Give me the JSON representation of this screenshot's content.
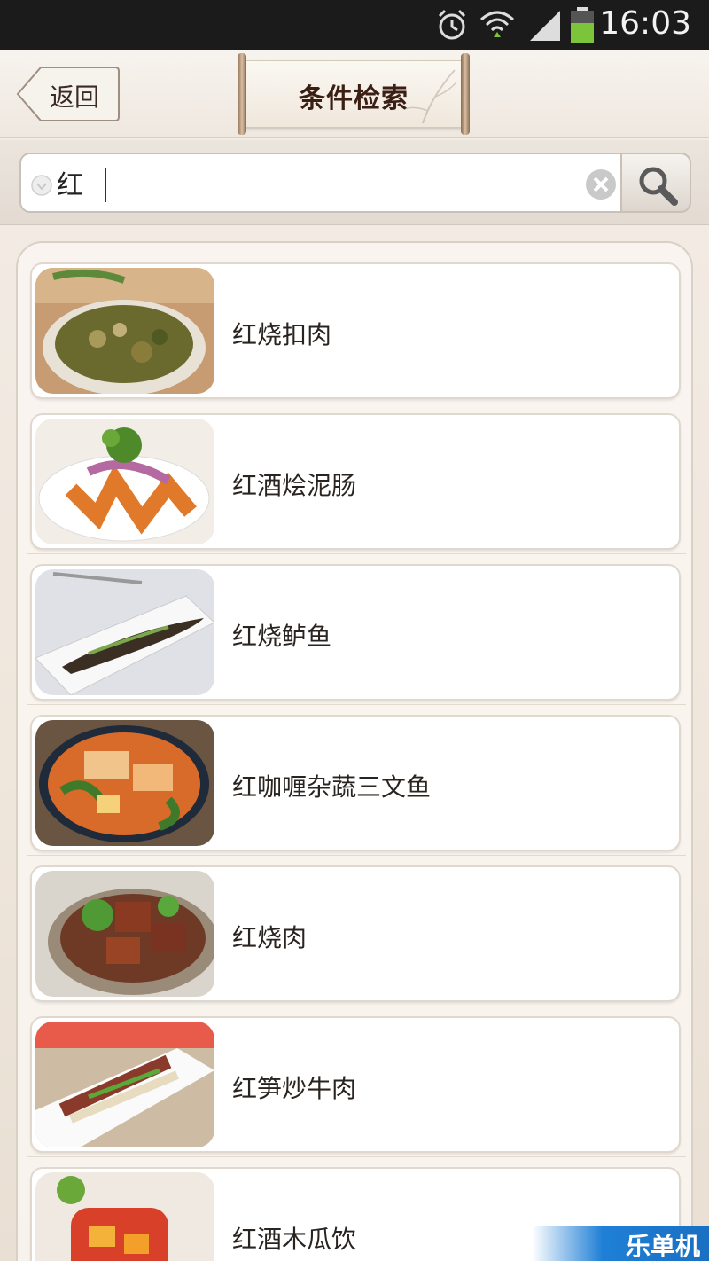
{
  "status_bar": {
    "time": "16:03",
    "icons": [
      "alarm-icon",
      "wifi-icon",
      "signal-icon",
      "battery-icon"
    ]
  },
  "header": {
    "back_label": "返回",
    "title": "条件检索"
  },
  "search": {
    "value": "红",
    "placeholder": ""
  },
  "results": [
    {
      "name": "红烧扣肉",
      "thumb": "braised-pork-pot"
    },
    {
      "name": "红酒烩泥肠",
      "thumb": "sausage-onion-plate"
    },
    {
      "name": "红烧鲈鱼",
      "thumb": "braised-fish-plate"
    },
    {
      "name": "红咖喱杂蔬三文鱼",
      "thumb": "curry-salmon-bowl"
    },
    {
      "name": "红烧肉",
      "thumb": "braised-pork-bowl"
    },
    {
      "name": "红笋炒牛肉",
      "thumb": "beef-stirfry-plate"
    },
    {
      "name": "红酒木瓜饮",
      "thumb": "papaya-wine-drink"
    }
  ],
  "watermark": "乐单机",
  "colors": {
    "status_bar": "#1b1b1b",
    "title_text": "#3b1f14",
    "battery": "#7cc43a"
  }
}
